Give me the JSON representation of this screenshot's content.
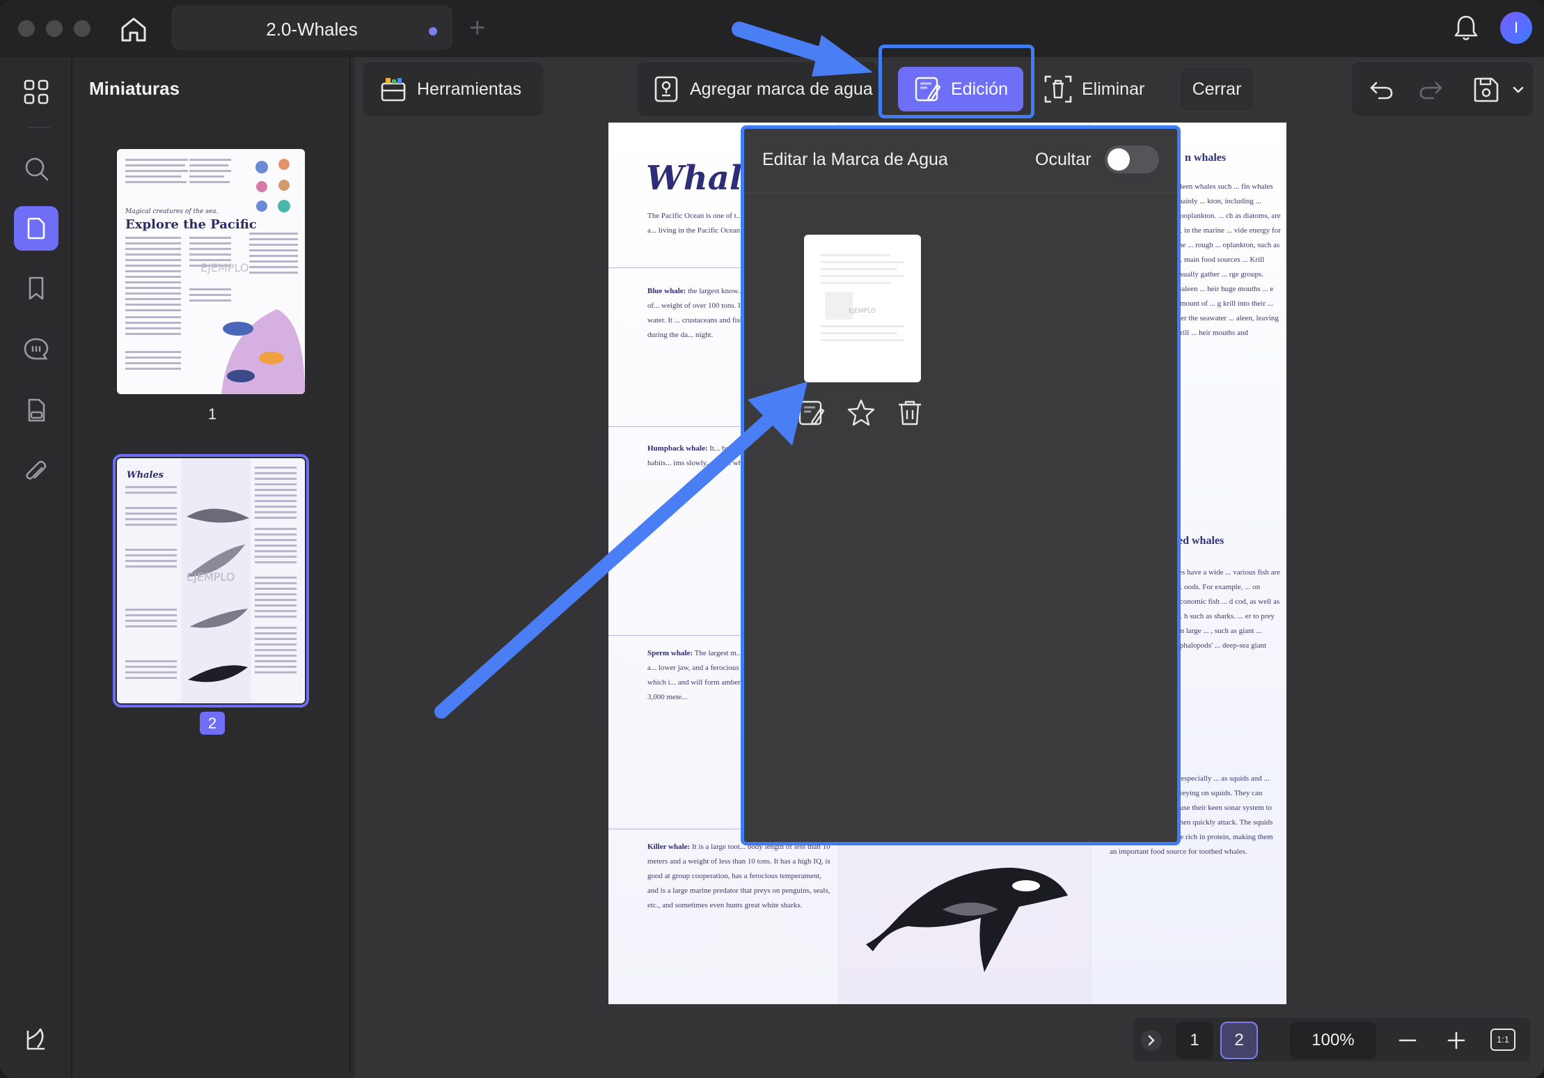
{
  "window": {
    "tab_title": "2.0-Whales"
  },
  "sidebar": {
    "panel_title": "Miniaturas",
    "thumbnails": [
      {
        "page": "1",
        "title": "Explore the Pacific",
        "subtitle": "Magical creatures of the sea.",
        "watermark": "EJEMPLO"
      },
      {
        "page": "2",
        "title": "Whales",
        "watermark": "EJEMPLO"
      }
    ]
  },
  "toolbar": {
    "tools_label": "Herramientas",
    "add_watermark_label": "Agregar marca de agua",
    "edit_label": "Edición",
    "delete_label": "Eliminar",
    "close_label": "Cerrar"
  },
  "popover": {
    "title": "Editar la Marca de Agua",
    "hide_label": "Ocultar",
    "hide_enabled": false,
    "watermark_sample": "EJEMPLO"
  },
  "document": {
    "title": "Whales",
    "intro": "The Pacific Ocean is one of t... are widely distributed. Here a... living in the Pacific Ocean:",
    "blue_whale_title": "Blue whale:",
    "blue_whale": "the largest know... world, with a body length of... weight of over 100 tons. Its b... appears blue in the water. It ... crustaceans and fish, and has... in the deep sea during the da... night.",
    "humpback_title": "Humpback whale:",
    "humpback": "It... back that looks li... has a gentle... habits... ims slowly... the ... whaling.",
    "sperm_title": "Sperm whale:",
    "sperm": "The largest m... toothed whale family, with a... lower jaw, and a ferocious te... feeds on giant squid, which i... and will form ambergris afte... a depth of nearly 3,000 mete...",
    "killer_title": "Killer whale:",
    "killer": "It is a large toot... body length of less than 10 meters and a weight of less than 10 tons. It has a high IQ, is good at group cooperation, has a ferocious temperament, and is a large marine predator that preys on penguins, seals, etc., and sometimes even hunts great white sharks.",
    "right_head_1": "n whales",
    "right_text_1": "aleen whales such ... fin whales mainly ... kton, including ... zooplankton. ... ch as diatoms, are ... in the marine ... vide energy for the ... rough ... oplankton, such as ... main food sources ... Krill usually gather ... rge groups. Baleen ... heir huge mouths ... e amount of ... g krill into their ... lter the seawater ... aleen, leaving krill ... heir mouths and",
    "right_head_2": "ed whales",
    "right_text_2": "les have a wide ... various fish are ... oods. For example, ... on economic fish ... d cod, as well as ... h such as sharks. ... er to prey on large ... , such as giant ... ephalopods' ... deep-sea giant",
    "right_text_3": "whales also prey ... ks, especially ... as squids and ... whales are experts in preying on squids. They can dive into the deep sea, use their keen sonar system to locate the squids, and then quickly attack. The squids have soft bodies and are rich in protein, making them an important food source for toothed whales."
  },
  "pagination": {
    "page_1": "1",
    "page_2": "2",
    "current_page": 2,
    "zoom": "100%",
    "fit_label": "1:1"
  },
  "colors": {
    "accent": "#6e6ef7",
    "highlight": "#3f7df2",
    "background": "#2b2b2e"
  }
}
